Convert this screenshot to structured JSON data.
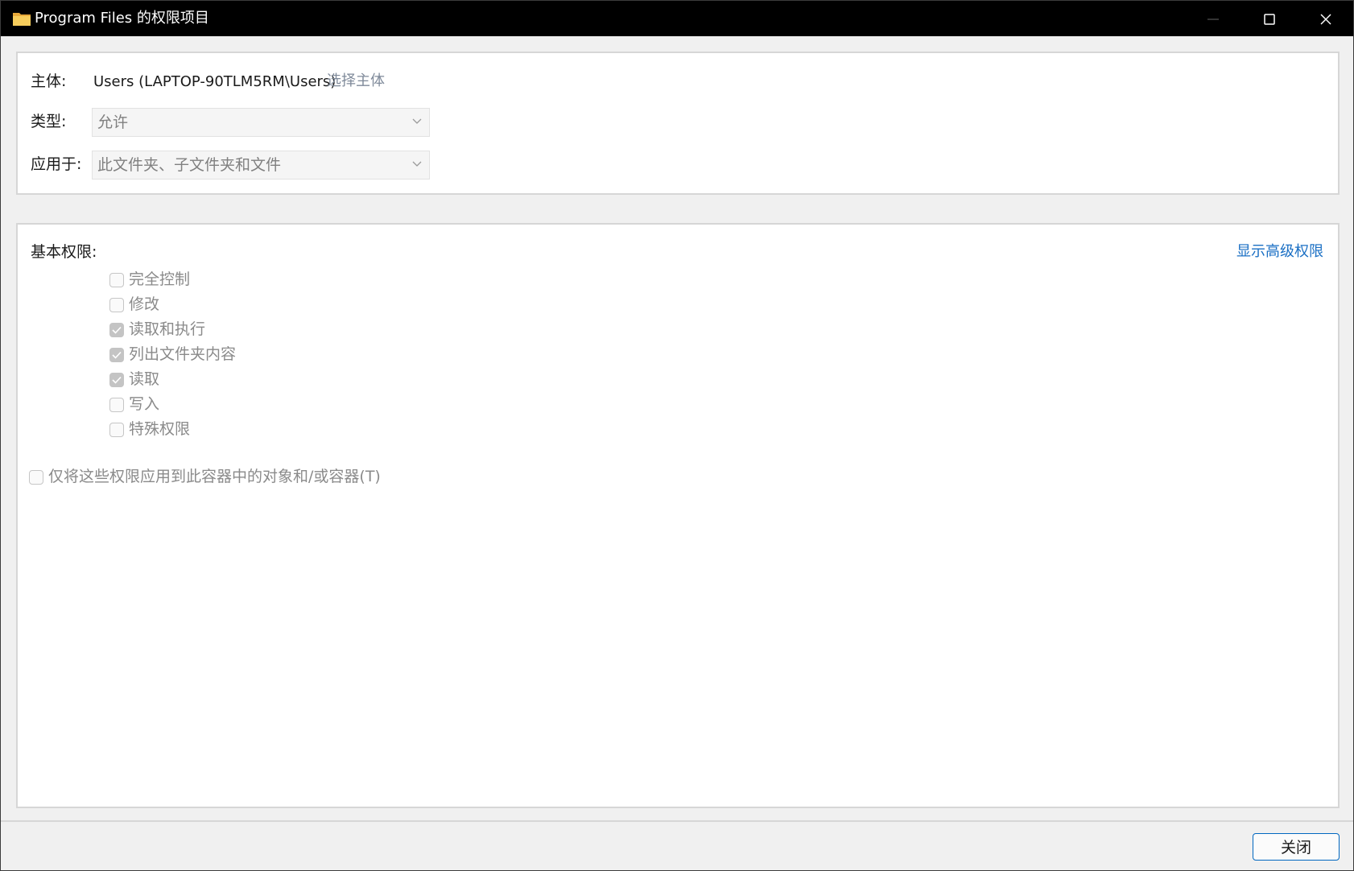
{
  "window": {
    "title": "Program Files 的权限项目",
    "icon": "folder-icon"
  },
  "principal": {
    "label": "主体:",
    "value": "Users (LAPTOP-90TLM5RM\\Users)",
    "select_link": "选择主体"
  },
  "type": {
    "label": "类型:",
    "selected": "允许"
  },
  "applies_to": {
    "label": "应用于:",
    "selected": "此文件夹、子文件夹和文件"
  },
  "basic_permissions": {
    "label": "基本权限:",
    "advanced_link": "显示高级权限",
    "items": [
      {
        "label": "完全控制",
        "checked": false
      },
      {
        "label": "修改",
        "checked": false
      },
      {
        "label": "读取和执行",
        "checked": true
      },
      {
        "label": "列出文件夹内容",
        "checked": true
      },
      {
        "label": "读取",
        "checked": true
      },
      {
        "label": "写入",
        "checked": false
      },
      {
        "label": "特殊权限",
        "checked": false
      }
    ]
  },
  "apply_only": {
    "label": "仅将这些权限应用到此容器中的对象和/或容器(T)",
    "checked": false
  },
  "footer": {
    "close_label": "关闭"
  },
  "colors": {
    "accent": "#0067c0",
    "link": "#1a6fc4",
    "titlebar": "#000000",
    "folder": "#f2c14e"
  }
}
